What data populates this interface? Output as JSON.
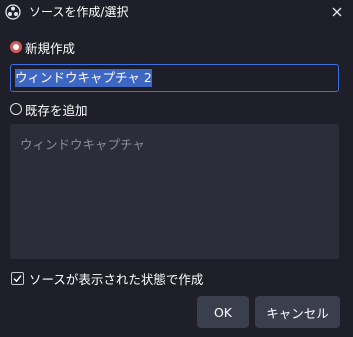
{
  "window": {
    "title": "ソースを作成/選択",
    "close_icon": "close-icon",
    "app_icon": "obs-logo-icon"
  },
  "create_new": {
    "label": "新規作成",
    "selected": true,
    "name_value": "ウィンドウキャプチャ 2"
  },
  "add_existing": {
    "label": "既存を追加",
    "selected": false,
    "items": [
      "ウィンドウキャプチャ"
    ]
  },
  "visible_checkbox": {
    "label": "ソースが表示された状態で作成",
    "checked": true
  },
  "buttons": {
    "ok_label": "OK",
    "cancel_label": "キャンセル"
  },
  "colors": {
    "background": "#1e1f28",
    "accent": "#3d6fe0",
    "radio_checked": "#d45a5a",
    "button": "#3b3e4d"
  }
}
